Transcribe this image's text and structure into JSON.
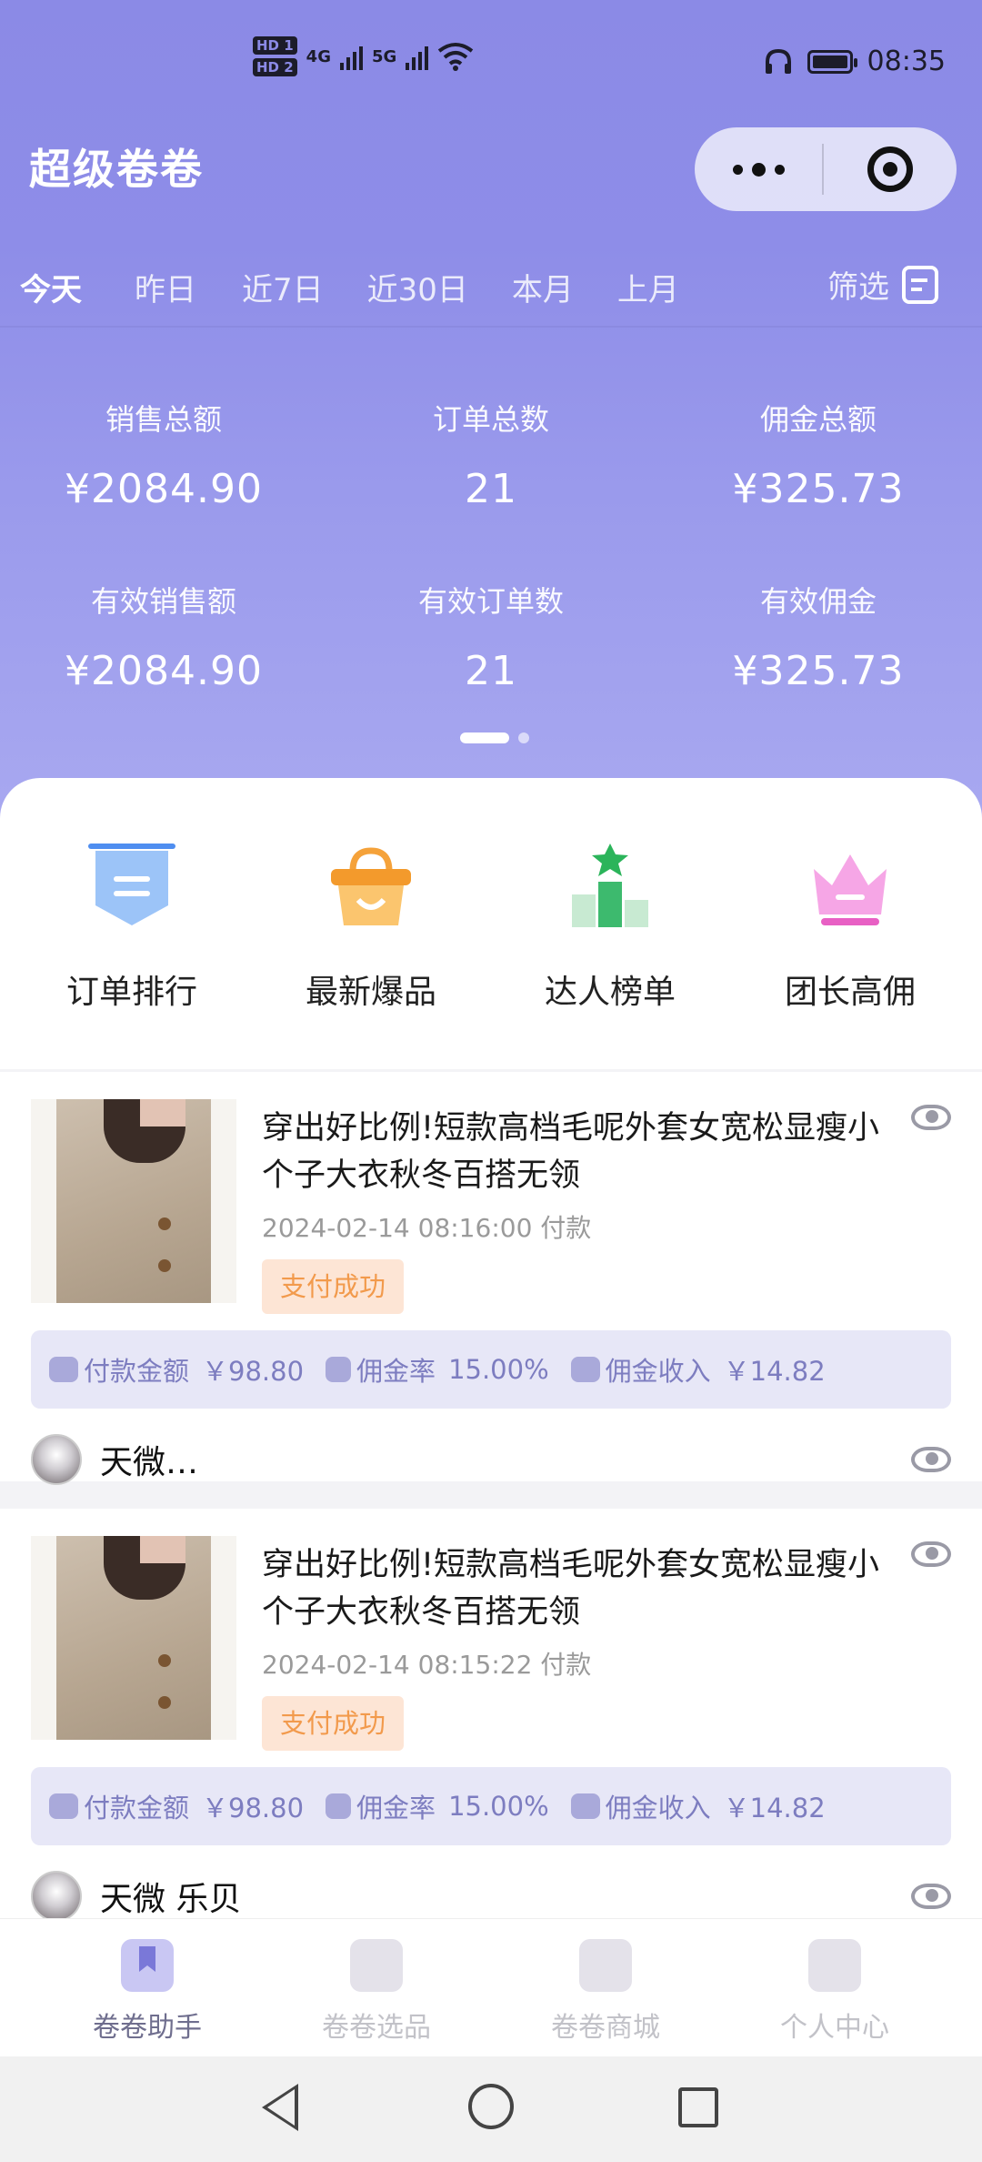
{
  "status_bar": {
    "hd1": "HD 1",
    "hd2": "HD 2",
    "net1": "4G",
    "net2": "5G",
    "time": "08:35"
  },
  "header": {
    "title": "超级卷卷"
  },
  "date_tabs": [
    "今天",
    "昨日",
    "近7日",
    "近30日",
    "本月",
    "上月"
  ],
  "filter_label": "筛选",
  "stats": [
    {
      "label": "销售总额",
      "value": "¥2084.90"
    },
    {
      "label": "订单总数",
      "value": "21"
    },
    {
      "label": "佣金总额",
      "value": "¥325.73"
    },
    {
      "label": "有效销售额",
      "value": "¥2084.90"
    },
    {
      "label": "有效订单数",
      "value": "21"
    },
    {
      "label": "有效佣金",
      "value": "¥325.73"
    }
  ],
  "quick_actions": [
    {
      "label": "订单排行",
      "icon": "ribbon-badge-icon",
      "color": "#5b9cf0"
    },
    {
      "label": "最新爆品",
      "icon": "basket-icon",
      "color": "#f5a23a"
    },
    {
      "label": "达人榜单",
      "icon": "podium-icon",
      "color": "#3dba6e"
    },
    {
      "label": "团长高佣",
      "icon": "crown-icon",
      "color": "#e860c4"
    }
  ],
  "orders": [
    {
      "title": "穿出好比例!短款高档毛呢外套女宽松显瘦小个子大衣秋冬百搭无领",
      "time": "2024-02-14 08:16:00 付款",
      "status": "支付成功",
      "pay_label": "付款金额",
      "pay_value": "￥98.80",
      "rate_label": "佣金率",
      "rate_value": "15.00%",
      "income_label": "佣金收入",
      "income_value": "￥14.82",
      "user": "天微…"
    },
    {
      "title": "穿出好比例!短款高档毛呢外套女宽松显瘦小个子大衣秋冬百搭无领",
      "time": "2024-02-14 08:15:22 付款",
      "status": "支付成功",
      "pay_label": "付款金额",
      "pay_value": "￥98.80",
      "rate_label": "佣金率",
      "rate_value": "15.00%",
      "income_label": "佣金收入",
      "income_value": "￥14.82",
      "user": "天微 乐贝"
    }
  ],
  "bottom_nav": [
    {
      "label": "卷卷助手",
      "active": true
    },
    {
      "label": "卷卷选品",
      "active": false
    },
    {
      "label": "卷卷商城",
      "active": false
    },
    {
      "label": "个人中心",
      "active": false
    }
  ],
  "colors": {
    "header": "#8b8ae6",
    "status_badge_bg": "#fde5d5",
    "status_badge_text": "#f29a4c",
    "info_bar_bg": "#e7e7f7",
    "info_bar_text": "#7d7dc0"
  }
}
